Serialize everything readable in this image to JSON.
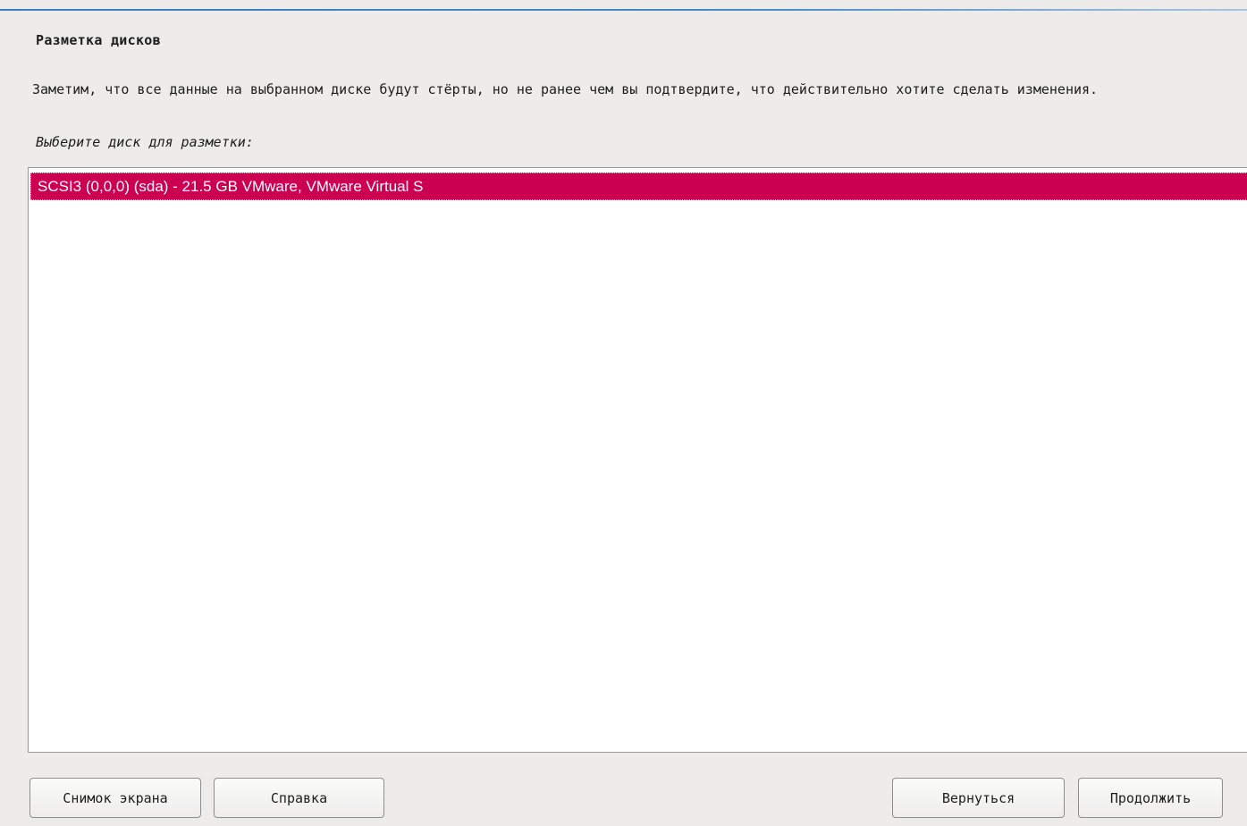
{
  "dialog": {
    "title": "Разметка дисков",
    "description": "Заметим, что все данные на выбранном диске будут стёрты, но не ранее чем вы подтвердите, что действительно хотите сделать изменения.",
    "prompt": "Выберите диск для разметки:"
  },
  "disk_list": {
    "items": [
      {
        "label": "SCSI3 (0,0,0) (sda) - 21.5 GB VMware, VMware Virtual S",
        "selected": true
      }
    ]
  },
  "buttons": {
    "screenshot_label": "Снимок экрана",
    "help_label": "Справка",
    "back_label": "Вернуться",
    "continue_label": "Продолжить"
  },
  "colors": {
    "selection": "#cc0050",
    "background": "#edeceb",
    "list_background": "#ffffff",
    "accent_line": "#3f7fbf"
  }
}
